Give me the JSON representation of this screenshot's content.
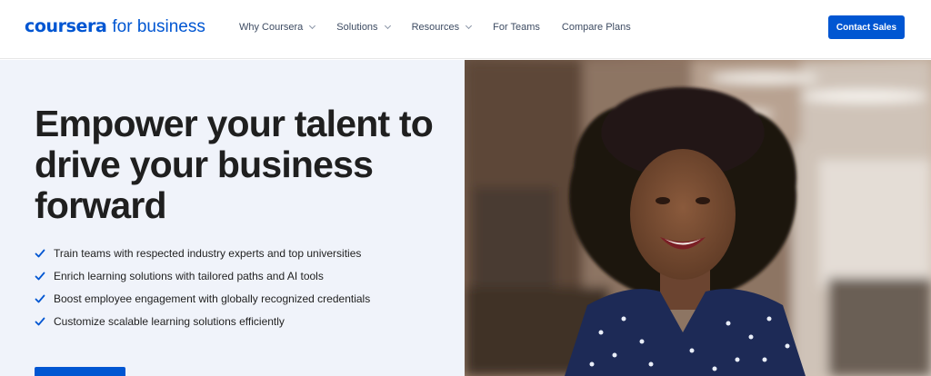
{
  "brand": {
    "word": "coursera",
    "suffix": "for business"
  },
  "nav": [
    {
      "label": "Why Coursera",
      "has_dropdown": true
    },
    {
      "label": "Solutions",
      "has_dropdown": true
    },
    {
      "label": "Resources",
      "has_dropdown": true
    },
    {
      "label": "For Teams",
      "has_dropdown": false
    },
    {
      "label": "Compare Plans",
      "has_dropdown": false
    }
  ],
  "header_cta": "Contact Sales",
  "hero": {
    "headline": "Empower your talent to drive your business forward",
    "bullets": [
      "Train teams with respected industry experts and top universities",
      "Enrich learning solutions with tailored paths and AI tools",
      "Boost employee engagement with globally recognized credentials",
      "Customize scalable learning solutions efficiently"
    ],
    "photo": "smiling-woman-office-photo"
  },
  "colors": {
    "brand_blue": "#0056d2",
    "hero_bg": "#f0f3fa",
    "text": "#1f1f1f",
    "nav_text": "#3d4b62"
  }
}
